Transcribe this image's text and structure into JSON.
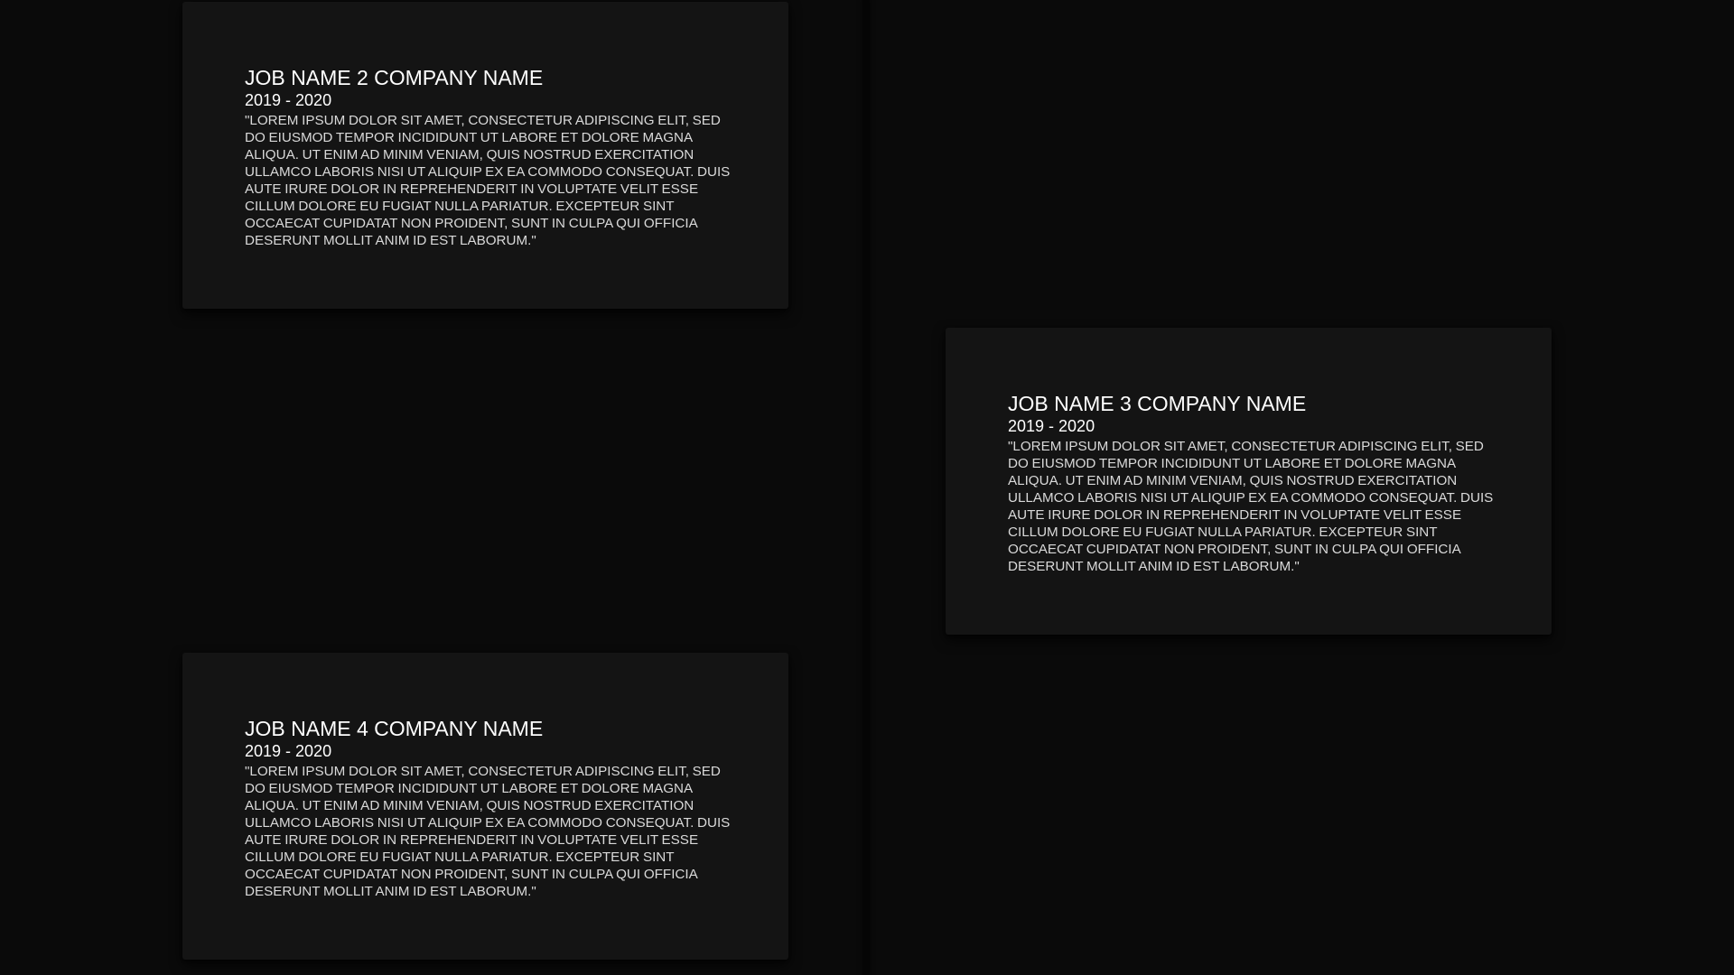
{
  "jobs": [
    {
      "title": "JOB NAME 2 COMPANY NAME",
      "dates": "2019 - 2020",
      "description": "\"LOREM IPSUM DOLOR SIT AMET, CONSECTETUR ADIPISCING ELIT, SED DO EIUSMOD TEMPOR INCIDIDUNT UT LABORE ET DOLORE MAGNA ALIQUA. UT ENIM AD MINIM VENIAM, QUIS NOSTRUD EXERCITATION ULLAMCO LABORIS NISI UT ALIQUIP EX EA COMMODO CONSEQUAT. DUIS AUTE IRURE DOLOR IN REPREHENDERIT IN VOLUPTATE VELIT ESSE CILLUM DOLORE EU FUGIAT NULLA PARIATUR. EXCEPTEUR SINT OCCAECAT CUPIDATAT NON PROIDENT, SUNT IN CULPA QUI OFFICIA DESERUNT MOLLIT ANIM ID EST LABORUM.\""
    },
    {
      "title": "JOB NAME 3 COMPANY NAME",
      "dates": "2019 - 2020",
      "description": "\"LOREM IPSUM DOLOR SIT AMET, CONSECTETUR ADIPISCING ELIT, SED DO EIUSMOD TEMPOR INCIDIDUNT UT LABORE ET DOLORE MAGNA ALIQUA. UT ENIM AD MINIM VENIAM, QUIS NOSTRUD EXERCITATION ULLAMCO LABORIS NISI UT ALIQUIP EX EA COMMODO CONSEQUAT. DUIS AUTE IRURE DOLOR IN REPREHENDERIT IN VOLUPTATE VELIT ESSE CILLUM DOLORE EU FUGIAT NULLA PARIATUR. EXCEPTEUR SINT OCCAECAT CUPIDATAT NON PROIDENT, SUNT IN CULPA QUI OFFICIA DESERUNT MOLLIT ANIM ID EST LABORUM.\""
    },
    {
      "title": "JOB NAME 4 COMPANY NAME",
      "dates": "2019 - 2020",
      "description": "\"LOREM IPSUM DOLOR SIT AMET, CONSECTETUR ADIPISCING ELIT, SED DO EIUSMOD TEMPOR INCIDIDUNT UT LABORE ET DOLORE MAGNA ALIQUA. UT ENIM AD MINIM VENIAM, QUIS NOSTRUD EXERCITATION ULLAMCO LABORIS NISI UT ALIQUIP EX EA COMMODO CONSEQUAT. DUIS AUTE IRURE DOLOR IN REPREHENDERIT IN VOLUPTATE VELIT ESSE CILLUM DOLORE EU FUGIAT NULLA PARIATUR. EXCEPTEUR SINT OCCAECAT CUPIDATAT NON PROIDENT, SUNT IN CULPA QUI OFFICIA DESERUNT MOLLIT ANIM ID EST LABORUM.\""
    }
  ],
  "colors": {
    "background": "#0a0a0a",
    "card": "#141414",
    "title_text": "#ffffff",
    "body_text": "#d9d9d9"
  }
}
